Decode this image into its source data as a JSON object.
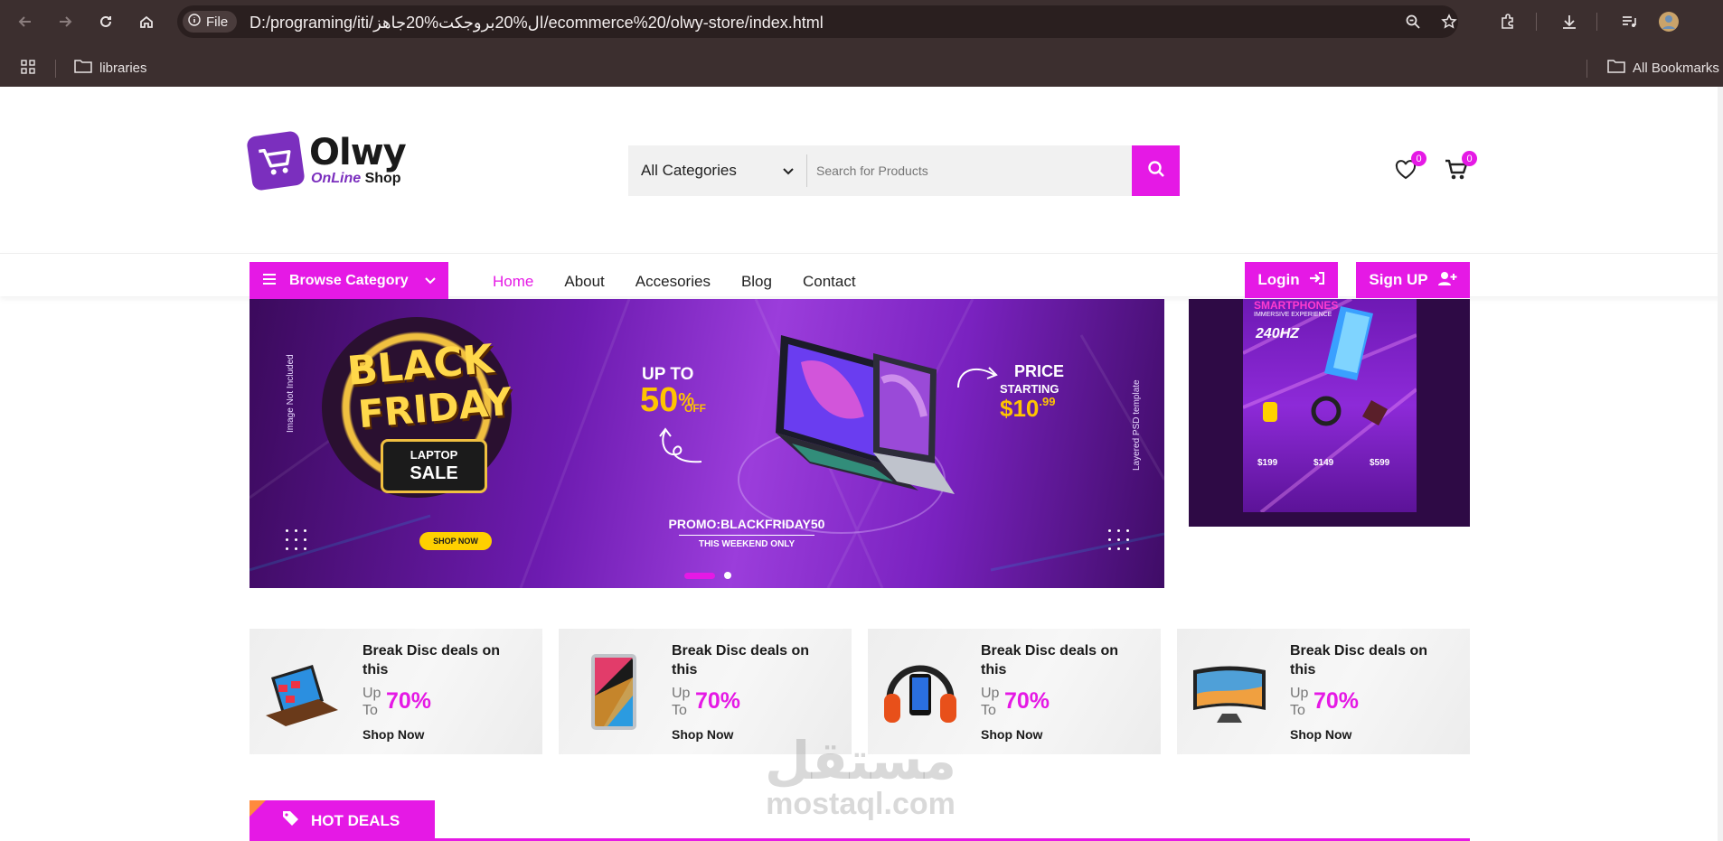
{
  "browser": {
    "chip_label": "File",
    "url": "D:/programing/iti/ال%20بروجكت%20جاهز/ecommerce%20/olwy-store/index.html",
    "bookmarks": [
      {
        "label": "libraries",
        "icon": "folder-icon"
      },
      {
        "label": "All Bookmarks",
        "icon": "folder-icon"
      }
    ]
  },
  "brand": {
    "name": "Olwy",
    "tagline_accent": "OnLine",
    "tagline_rest": "Shop",
    "accent_color": "#e519e5",
    "logo_color": "#7b2fbe"
  },
  "search": {
    "category_selected": "All Categories",
    "placeholder": "Search for Products"
  },
  "header_counts": {
    "wishlist": "0",
    "cart": "0"
  },
  "nav": {
    "browse_label": "Browse Category",
    "items": [
      {
        "label": "Home",
        "active": true
      },
      {
        "label": "About",
        "active": false
      },
      {
        "label": "Accesories",
        "active": false
      },
      {
        "label": "Blog",
        "active": false
      },
      {
        "label": "Contact",
        "active": false
      }
    ],
    "login_label": "Login",
    "signup_label": "Sign UP"
  },
  "hero": {
    "side_left": "Image Not Included",
    "side_right": "Layered PSD template",
    "black": "BLACK",
    "friday": "FRIDAY",
    "laptop_line": "LAPTOP",
    "sale_line": "SALE",
    "shop_now": "SHOP NOW",
    "up_to": "UP TO",
    "percent": "50",
    "percent_sign": "%",
    "off": "OFF",
    "price": "PRICE",
    "starting": "STARTING",
    "price_value": "$10",
    "price_cents": ".99",
    "promo": "PROMO:BLACKFRIDAY50",
    "weekend": "THIS WEEKEND ONLY",
    "active_slide": 1,
    "slide_count": 2
  },
  "side_banner": {
    "title": "SMARTPHONES",
    "subtitle": "IMMERSIVE EXPERIENCE",
    "hz": "240HZ",
    "prices": [
      "$199",
      "$149",
      "$599"
    ]
  },
  "deals": [
    {
      "title": "Break Disc deals on this",
      "up": "Up",
      "to": "To",
      "percent": "70%",
      "shop": "Shop Now",
      "icon": "laptop-icon"
    },
    {
      "title": "Break Disc deals on this",
      "up": "Up",
      "to": "To",
      "percent": "70%",
      "shop": "Shop Now",
      "icon": "tablet-icon"
    },
    {
      "title": "Break Disc deals on this",
      "up": "Up",
      "to": "To",
      "percent": "70%",
      "shop": "Shop Now",
      "icon": "headphones-icon"
    },
    {
      "title": "Break Disc deals on this",
      "up": "Up",
      "to": "To",
      "percent": "70%",
      "shop": "Shop Now",
      "icon": "tv-icon"
    }
  ],
  "hot_deals_label": "HOT DEALS",
  "watermark": {
    "arabic": "مستقل",
    "latin": "mostaql.com"
  }
}
